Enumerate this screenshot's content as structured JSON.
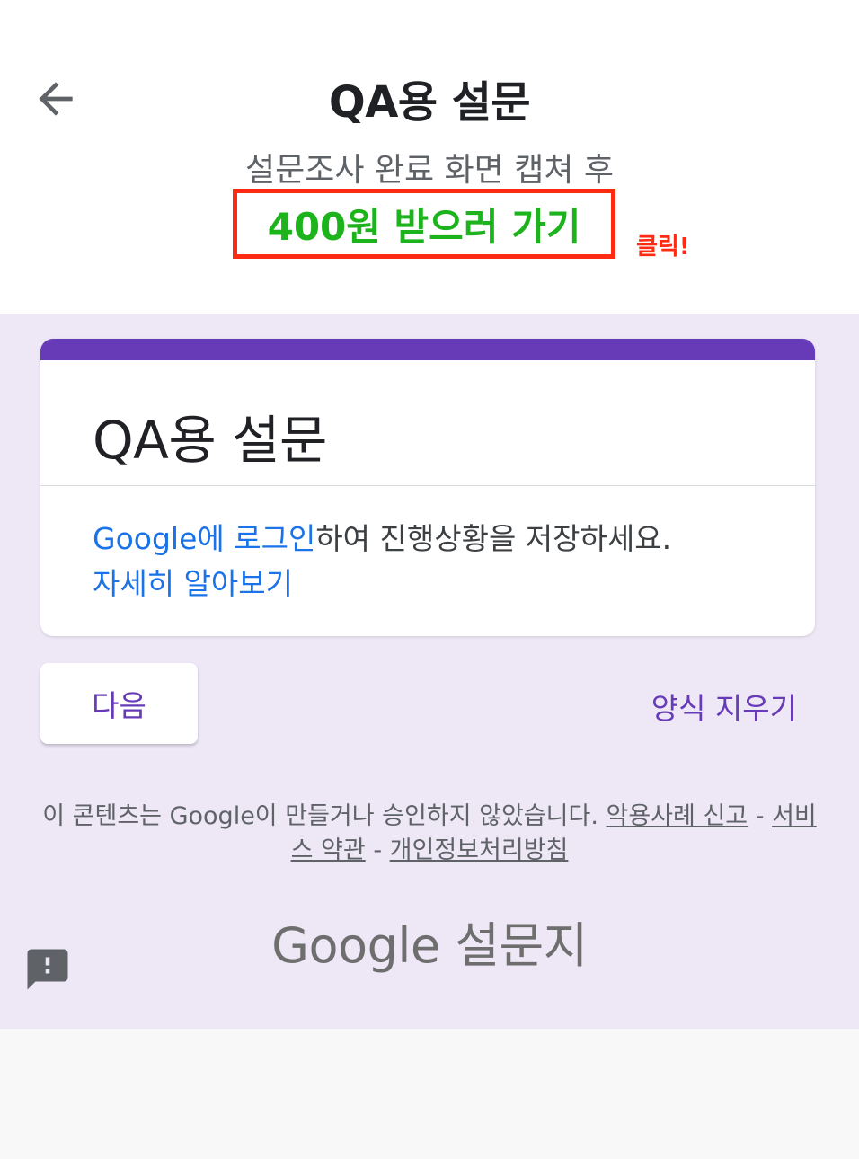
{
  "header": {
    "title": "QA용 설문",
    "subtitle": "설문조사 완료 화면 캡쳐 후",
    "cta_label": "400원 받으러 가기",
    "click_note": "클릭!"
  },
  "form": {
    "title": "QA용 설문",
    "login_link": "Google에 로그인",
    "login_rest": "하여 진행상황을 저장하세요.",
    "learn_more": "자세히 알아보기",
    "next_button": "다음",
    "clear_form": "양식 지우기"
  },
  "footer": {
    "disclaimer": "이 콘텐츠는 Google이 만들거나 승인하지 않았습니다.",
    "abuse_link": "악용사례 신고",
    "sep1": "-",
    "terms_link": "서비스 약관",
    "sep2": "-",
    "privacy_link": "개인정보처리방침",
    "brand": "Google 설문지"
  },
  "icons": {
    "back": "arrow-left-icon",
    "feedback": "report-feedback-icon"
  },
  "colors": {
    "accent": "#673ab7",
    "link": "#1a73e8",
    "cta_text": "#1db31d",
    "highlight": "#ff2a12",
    "form_bg": "#ede7f6"
  }
}
